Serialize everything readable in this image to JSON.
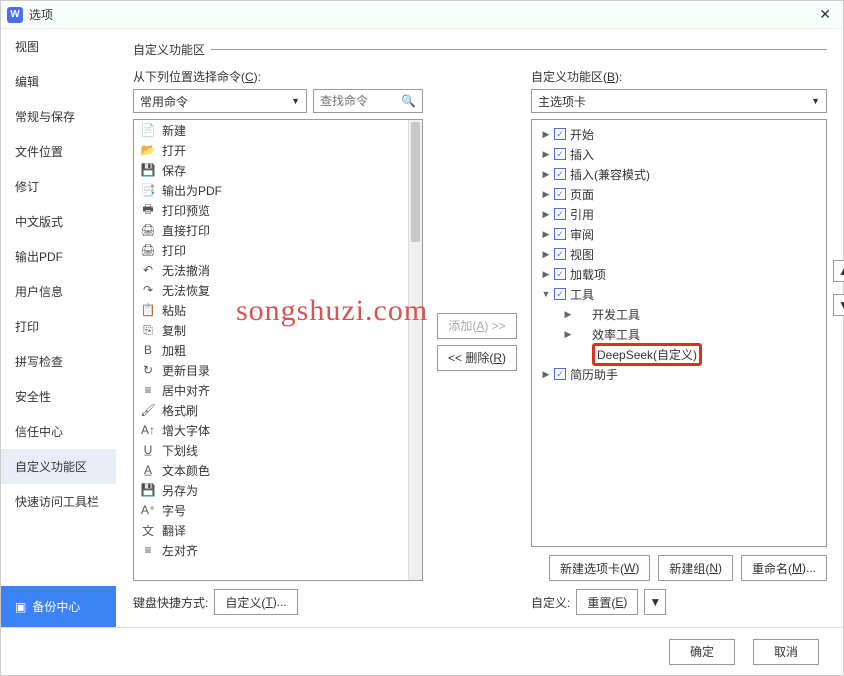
{
  "title": "选项",
  "watermark": "songshuzi.com",
  "sidebar": {
    "items": [
      "视图",
      "编辑",
      "常规与保存",
      "文件位置",
      "修订",
      "中文版式",
      "输出PDF",
      "用户信息",
      "打印",
      "拼写检查",
      "安全性",
      "信任中心",
      "自定义功能区",
      "快速访问工具栏"
    ],
    "activeIndex": 12,
    "backup": "备份中心"
  },
  "main": {
    "sectionTitle": "自定义功能区",
    "leftLabel": "从下列位置选择命令(C):",
    "leftLabelKey": "C",
    "leftSelect": "常用命令",
    "searchPlaceholder": "查找命令",
    "commands": [
      {
        "icon": "📄",
        "label": "新建"
      },
      {
        "icon": "📂",
        "label": "打开"
      },
      {
        "icon": "💾",
        "label": "保存"
      },
      {
        "icon": "📑",
        "label": "输出为PDF"
      },
      {
        "icon": "🖶",
        "label": "打印预览"
      },
      {
        "icon": "🖨",
        "label": "直接打印"
      },
      {
        "icon": "🖨",
        "label": "打印"
      },
      {
        "icon": "↶",
        "label": "无法撤消"
      },
      {
        "icon": "↷",
        "label": "无法恢复"
      },
      {
        "icon": "📋",
        "label": "粘贴"
      },
      {
        "icon": "⎘",
        "label": "复制"
      },
      {
        "icon": "B",
        "label": "加粗"
      },
      {
        "icon": "↻",
        "label": "更新目录"
      },
      {
        "icon": "≡",
        "label": "居中对齐"
      },
      {
        "icon": "🖌",
        "label": "格式刷"
      },
      {
        "icon": "A↑",
        "label": "增大字体"
      },
      {
        "icon": "U̲",
        "label": "下划线"
      },
      {
        "icon": "A̲",
        "label": "文本颜色"
      },
      {
        "icon": "💾",
        "label": "另存为"
      },
      {
        "icon": "A⁺",
        "label": "字号"
      },
      {
        "icon": "文",
        "label": "翻译"
      },
      {
        "icon": "≡",
        "label": "左对齐"
      }
    ],
    "addBtn": "添加(A) >>",
    "removeBtn": "<< 删除(R)",
    "rightLabel": "自定义功能区(B):",
    "rightSelect": "主选项卡",
    "tree": [
      {
        "exp": "▶",
        "chk": true,
        "label": "开始",
        "indent": 0
      },
      {
        "exp": "▶",
        "chk": true,
        "label": "插入",
        "indent": 0
      },
      {
        "exp": "▶",
        "chk": true,
        "label": "插入(兼容模式)",
        "indent": 0
      },
      {
        "exp": "▶",
        "chk": true,
        "label": "页面",
        "indent": 0
      },
      {
        "exp": "▶",
        "chk": true,
        "label": "引用",
        "indent": 0
      },
      {
        "exp": "▶",
        "chk": true,
        "label": "审阅",
        "indent": 0
      },
      {
        "exp": "▶",
        "chk": true,
        "label": "视图",
        "indent": 0
      },
      {
        "exp": "▶",
        "chk": true,
        "label": "加载项",
        "indent": 0
      },
      {
        "exp": "▼",
        "chk": true,
        "label": "工具",
        "indent": 0
      },
      {
        "exp": "▶",
        "chk": null,
        "label": "开发工具",
        "indent": 1
      },
      {
        "exp": "▶",
        "chk": null,
        "label": "效率工具",
        "indent": 1
      },
      {
        "exp": "",
        "chk": null,
        "label": "DeepSeek(自定义)",
        "indent": 1,
        "hl": true
      },
      {
        "exp": "▶",
        "chk": true,
        "label": "简历助手",
        "indent": 0
      }
    ],
    "newTabBtn": "新建选项卡(W)",
    "newGroupBtn": "新建组(N)",
    "renameBtn": "重命名(M)...",
    "kbLabel": "键盘快捷方式:",
    "kbBtn": "自定义(T)...",
    "customLabel": "自定义:",
    "resetBtn": "重置(E)"
  },
  "footer": {
    "ok": "确定",
    "cancel": "取消"
  }
}
